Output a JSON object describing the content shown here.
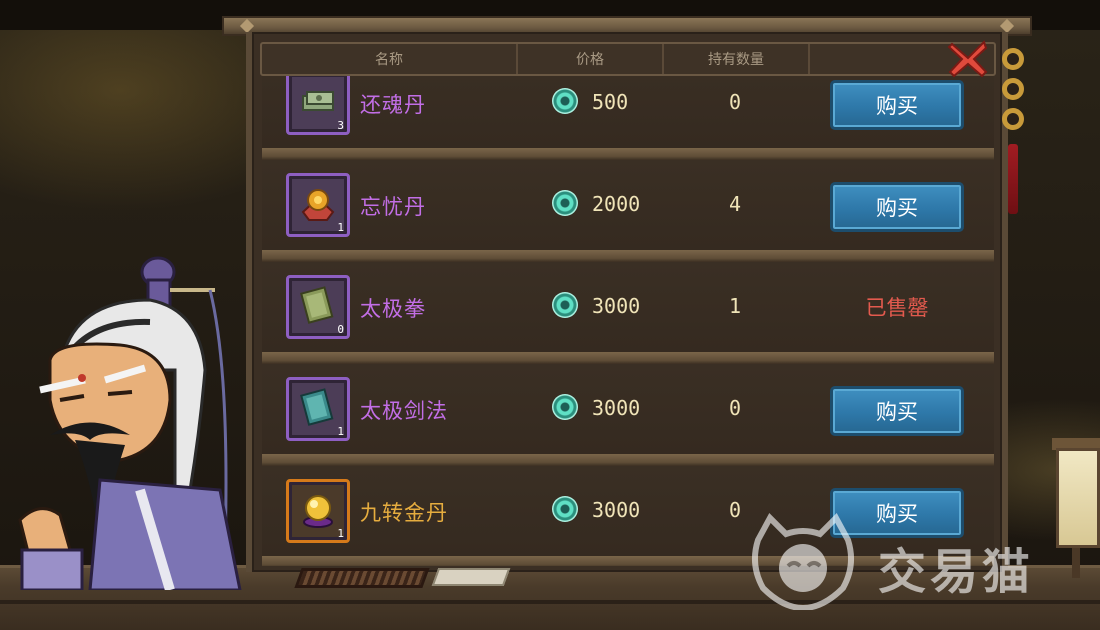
{
  "header": {
    "col_name": "名称",
    "col_price": "价格",
    "col_qty": "持有数量",
    "col_action": ""
  },
  "items": [
    {
      "name": "还魂丹",
      "price": "500",
      "qty": "0",
      "count": "3",
      "icon": "money-bundle-icon",
      "rarity": "purple",
      "action": "购买"
    },
    {
      "name": "忘忧丹",
      "price": "2000",
      "qty": "4",
      "count": "1",
      "icon": "golden-pill-icon",
      "rarity": "purple",
      "action": "购买"
    },
    {
      "name": "太极拳",
      "price": "3000",
      "qty": "1",
      "count": "0",
      "icon": "green-book-icon",
      "rarity": "purple",
      "status": "已售罄"
    },
    {
      "name": "太极剑法",
      "price": "3000",
      "qty": "0",
      "count": "1",
      "icon": "teal-book-icon",
      "rarity": "purple",
      "action": "购买"
    },
    {
      "name": "九转金丹",
      "price": "3000",
      "qty": "0",
      "count": "1",
      "icon": "golden-orb-icon",
      "rarity": "gold",
      "action": "购买"
    }
  ],
  "watermark": {
    "text": "交易猫"
  },
  "colors": {
    "purple_name": "#c26ee6",
    "gold_name": "#e6ad3f",
    "buy_button": "#2e78a9",
    "soldout_text": "#e35a4e"
  }
}
